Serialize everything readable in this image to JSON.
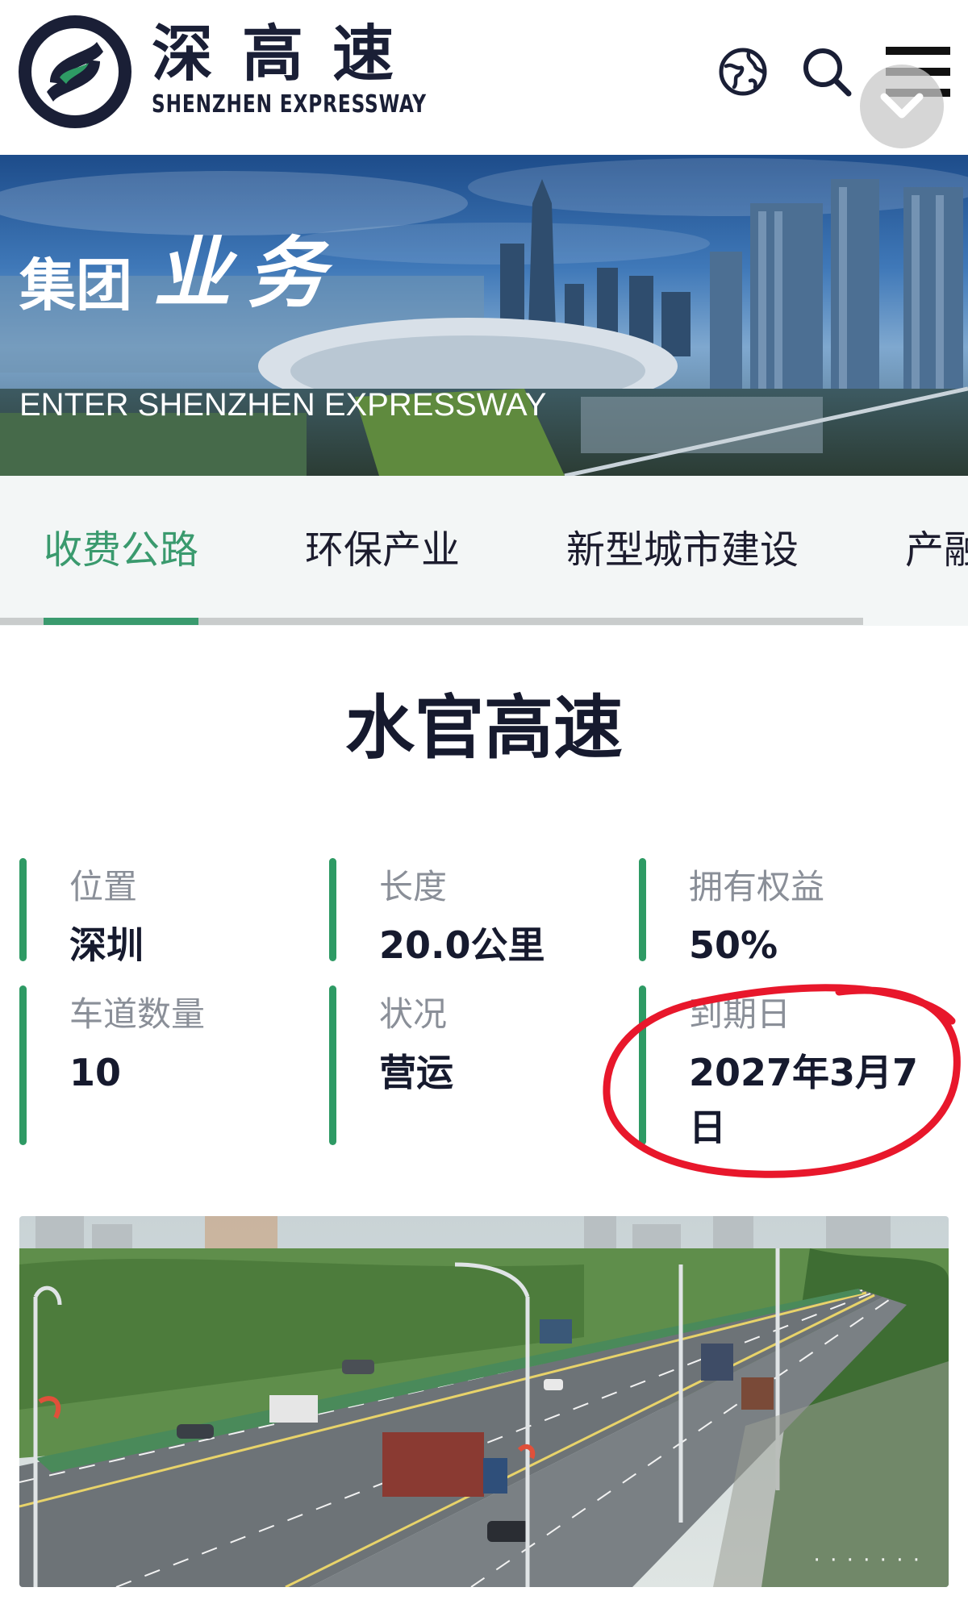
{
  "header": {
    "brand_cn": "深高速",
    "brand_en": "SHENZHEN EXPRESSWAY"
  },
  "banner": {
    "title_part1": "集团",
    "title_part2": "业务",
    "subtitle": "ENTER SHENZHEN EXPRESSWAY"
  },
  "tabs": [
    {
      "label": "收费公路",
      "active": true
    },
    {
      "label": "环保产业",
      "active": false
    },
    {
      "label": "新型城市建设",
      "active": false
    },
    {
      "label": "产融",
      "active": false
    }
  ],
  "project": {
    "title": "水官高速",
    "info": [
      {
        "label": "位置",
        "value": "深圳"
      },
      {
        "label": "长度",
        "value": "20.0公里"
      },
      {
        "label": "拥有权益",
        "value": "50%"
      },
      {
        "label": "车道数量",
        "value": "10"
      },
      {
        "label": "状况",
        "value": "营运"
      },
      {
        "label": "到期日",
        "value": "2027年3月7日"
      }
    ]
  },
  "colors": {
    "accent_green": "#3a9a6e",
    "bar_green": "#2e9a64",
    "navy": "#1a1f36",
    "annotation_red": "#e8172b"
  },
  "icons": [
    "logo-icon",
    "globe-icon",
    "search-icon",
    "menu-icon",
    "chevron-down-icon"
  ]
}
